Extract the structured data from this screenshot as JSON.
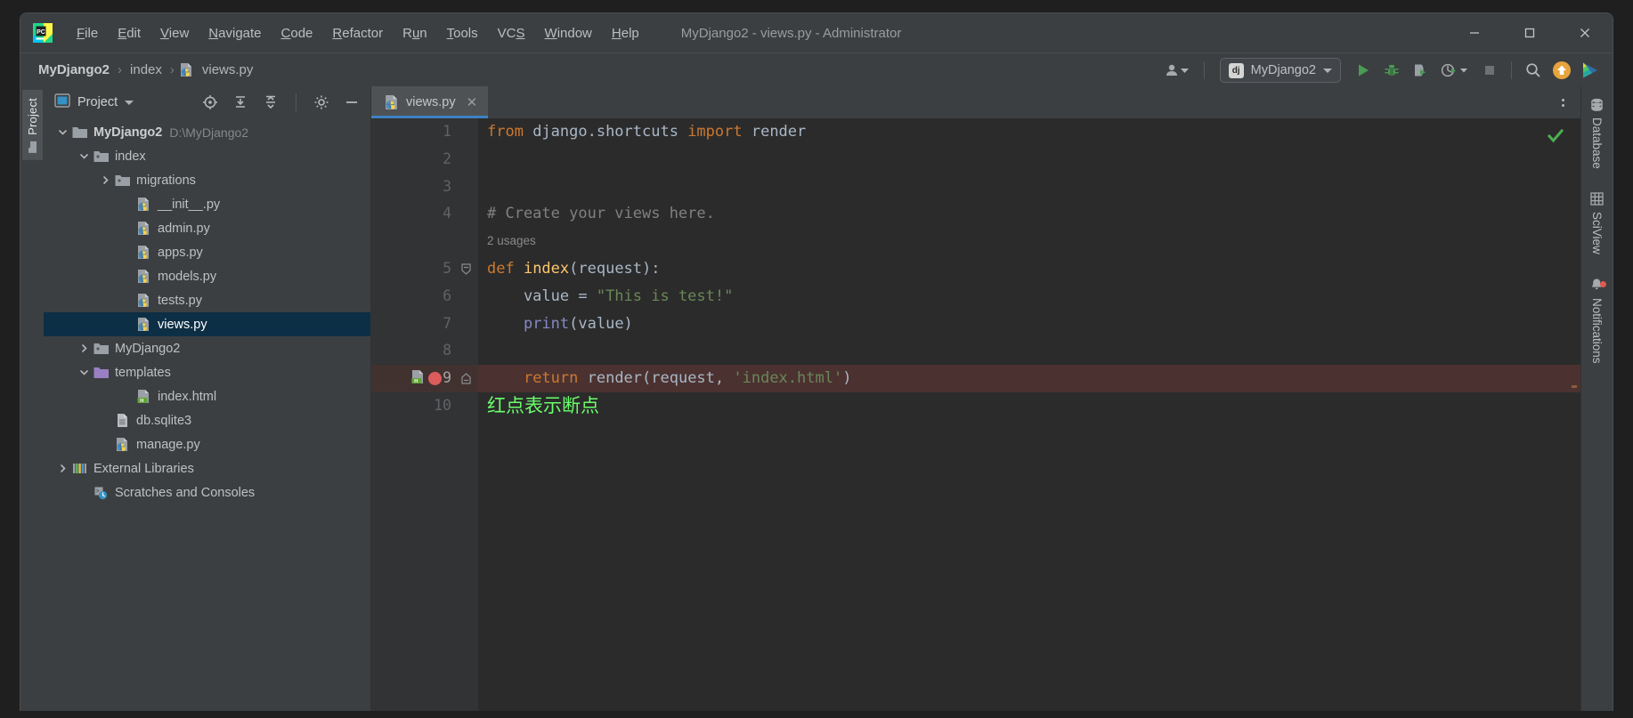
{
  "window": {
    "title": "MyDjango2 - views.py - Administrator",
    "logo_icon": "pycharm-logo-icon",
    "controls": [
      {
        "name": "minimize-button",
        "glyph": "—"
      },
      {
        "name": "maximize-button",
        "glyph": "☐"
      },
      {
        "name": "close-button",
        "glyph": "✕"
      }
    ]
  },
  "menubar": {
    "items": [
      {
        "label": "File",
        "mnemonic": "F"
      },
      {
        "label": "Edit",
        "mnemonic": "E"
      },
      {
        "label": "View",
        "mnemonic": "V"
      },
      {
        "label": "Navigate",
        "mnemonic": "N"
      },
      {
        "label": "Code",
        "mnemonic": "C"
      },
      {
        "label": "Refactor",
        "mnemonic": "R"
      },
      {
        "label": "Run",
        "mnemonic": "u"
      },
      {
        "label": "Tools",
        "mnemonic": "T"
      },
      {
        "label": "VCS",
        "mnemonic": "S"
      },
      {
        "label": "Window",
        "mnemonic": "W"
      },
      {
        "label": "Help",
        "mnemonic": "H"
      }
    ]
  },
  "navbar": {
    "breadcrumbs": [
      {
        "label": "MyDjango2",
        "bold": true,
        "icon": ""
      },
      {
        "label": "index",
        "bold": false,
        "icon": ""
      },
      {
        "label": "views.py",
        "bold": false,
        "icon": "python-file-icon"
      }
    ],
    "separator": "›",
    "run_config": {
      "label": "MyDjango2",
      "badge": "dj",
      "icon": "django-icon"
    },
    "toolbar_buttons": [
      {
        "name": "user-settings-icon",
        "label": "Settings sync account"
      },
      {
        "name": "run-button",
        "label": "Run"
      },
      {
        "name": "debug-button",
        "label": "Debug"
      },
      {
        "name": "run-with-coverage-button",
        "label": "Run with Coverage"
      },
      {
        "name": "profile-button",
        "label": "Profile"
      },
      {
        "name": "stop-button",
        "label": "Stop"
      },
      {
        "name": "search-everywhere-icon",
        "label": "Search Everywhere"
      },
      {
        "name": "update-project-icon",
        "label": "Update Project"
      },
      {
        "name": "ide-feature-icon",
        "label": "IDE Feature"
      }
    ]
  },
  "left_strip": {
    "tab": {
      "label": "Project",
      "icon": "folder-icon"
    }
  },
  "project_panel": {
    "title": "Project",
    "header_buttons": [
      {
        "name": "select-opened-file-icon",
        "label": "Select Opened File"
      },
      {
        "name": "expand-all-icon",
        "label": "Expand All"
      },
      {
        "name": "collapse-all-icon",
        "label": "Collapse All"
      },
      {
        "name": "settings-gear-icon",
        "label": "Options"
      },
      {
        "name": "hide-panel-icon",
        "label": "Hide"
      }
    ],
    "tree": [
      {
        "label": "MyDjango2",
        "path": "D:\\MyDjango2",
        "indent": 0,
        "arrow": "down",
        "icon": "folder-icon",
        "bold": true,
        "selected": false
      },
      {
        "label": "index",
        "path": "",
        "indent": 1,
        "arrow": "down",
        "icon": "module-folder-icon",
        "bold": false,
        "selected": false
      },
      {
        "label": "migrations",
        "path": "",
        "indent": 2,
        "arrow": "right",
        "icon": "module-folder-icon",
        "bold": false,
        "selected": false
      },
      {
        "label": "__init__.py",
        "path": "",
        "indent": 3,
        "arrow": "none",
        "icon": "python-file-icon",
        "bold": false,
        "selected": false
      },
      {
        "label": "admin.py",
        "path": "",
        "indent": 3,
        "arrow": "none",
        "icon": "python-file-icon",
        "bold": false,
        "selected": false
      },
      {
        "label": "apps.py",
        "path": "",
        "indent": 3,
        "arrow": "none",
        "icon": "python-file-icon",
        "bold": false,
        "selected": false
      },
      {
        "label": "models.py",
        "path": "",
        "indent": 3,
        "arrow": "none",
        "icon": "python-file-icon",
        "bold": false,
        "selected": false
      },
      {
        "label": "tests.py",
        "path": "",
        "indent": 3,
        "arrow": "none",
        "icon": "python-file-icon",
        "bold": false,
        "selected": false
      },
      {
        "label": "views.py",
        "path": "",
        "indent": 3,
        "arrow": "none",
        "icon": "python-file-icon",
        "bold": false,
        "selected": true
      },
      {
        "label": "MyDjango2",
        "path": "",
        "indent": 1,
        "arrow": "right",
        "icon": "module-folder-icon",
        "bold": false,
        "selected": false
      },
      {
        "label": "templates",
        "path": "",
        "indent": 1,
        "arrow": "down",
        "icon": "templates-folder-icon",
        "bold": false,
        "selected": false
      },
      {
        "label": "index.html",
        "path": "",
        "indent": 3,
        "arrow": "none",
        "icon": "html-file-icon",
        "bold": false,
        "selected": false
      },
      {
        "label": "db.sqlite3",
        "path": "",
        "indent": 2,
        "arrow": "none",
        "icon": "sqlite-file-icon",
        "bold": false,
        "selected": false
      },
      {
        "label": "manage.py",
        "path": "",
        "indent": 2,
        "arrow": "none",
        "icon": "python-file-icon",
        "bold": false,
        "selected": false
      },
      {
        "label": "External Libraries",
        "path": "",
        "indent": 0,
        "arrow": "right",
        "icon": "libraries-icon",
        "bold": false,
        "selected": false
      },
      {
        "label": "Scratches and Consoles",
        "path": "",
        "indent": 1,
        "arrow": "none",
        "icon": "scratches-icon",
        "bold": false,
        "selected": false
      }
    ]
  },
  "editor": {
    "tabs": [
      {
        "label": "views.py",
        "icon": "python-file-icon",
        "active": true,
        "close_glyph": "✕"
      }
    ],
    "more_options": "vertical-dots-icon",
    "inspection_status": "ok",
    "lines": [
      {
        "num": "1",
        "tokens": [
          {
            "t": "from ",
            "c": "kw"
          },
          {
            "t": "django.shortcuts ",
            "c": "id"
          },
          {
            "t": "import ",
            "c": "kw"
          },
          {
            "t": "render",
            "c": "id"
          }
        ]
      },
      {
        "num": "2",
        "tokens": []
      },
      {
        "num": "3",
        "tokens": []
      },
      {
        "num": "4",
        "tokens": [
          {
            "t": "# Create your views here.",
            "c": "cm"
          }
        ]
      },
      {
        "num": "",
        "hint": "2 usages"
      },
      {
        "num": "5",
        "fold": true,
        "tokens": [
          {
            "t": "def ",
            "c": "kw"
          },
          {
            "t": "index",
            "c": "fn"
          },
          {
            "t": "(request):",
            "c": "id"
          }
        ]
      },
      {
        "num": "6",
        "tokens": [
          {
            "t": "    value = ",
            "c": "id"
          },
          {
            "t": "\"This is test!\"",
            "c": "str"
          }
        ]
      },
      {
        "num": "7",
        "tokens": [
          {
            "t": "    ",
            "c": "id"
          },
          {
            "t": "print",
            "c": "bi"
          },
          {
            "t": "(value)",
            "c": "id"
          }
        ]
      },
      {
        "num": "8",
        "tokens": []
      },
      {
        "num": "9",
        "highlight": true,
        "breakpoint": true,
        "marker": "html-file-icon",
        "foldend": true,
        "tokens": [
          {
            "t": "    ",
            "c": "id"
          },
          {
            "t": "return ",
            "c": "kw"
          },
          {
            "t": "render(request, ",
            "c": "id"
          },
          {
            "t": "'index.html'",
            "c": "str"
          },
          {
            "t": ")",
            "c": "id"
          }
        ]
      },
      {
        "num": "10",
        "annotation": "红点表示断点"
      }
    ]
  },
  "right_strip": {
    "tabs": [
      {
        "label": "Database",
        "icon": "database-icon",
        "badge": false
      },
      {
        "label": "SciView",
        "icon": "grid-icon",
        "badge": false
      },
      {
        "label": "Notifications",
        "icon": "bell-icon",
        "badge": true
      }
    ]
  },
  "colors": {
    "accent": "#3d81c4",
    "keyword": "#cc7832",
    "string": "#6a8759",
    "function": "#ffc66d",
    "comment": "#808080",
    "identifier": "#a9b7c6",
    "builtin": "#8888c6",
    "annotation": "#6aff6a",
    "breakpoint": "#db5c5c",
    "selection": "#0d2f45",
    "highlight_row": "#4b3230",
    "ok_check": "#4caf50"
  }
}
